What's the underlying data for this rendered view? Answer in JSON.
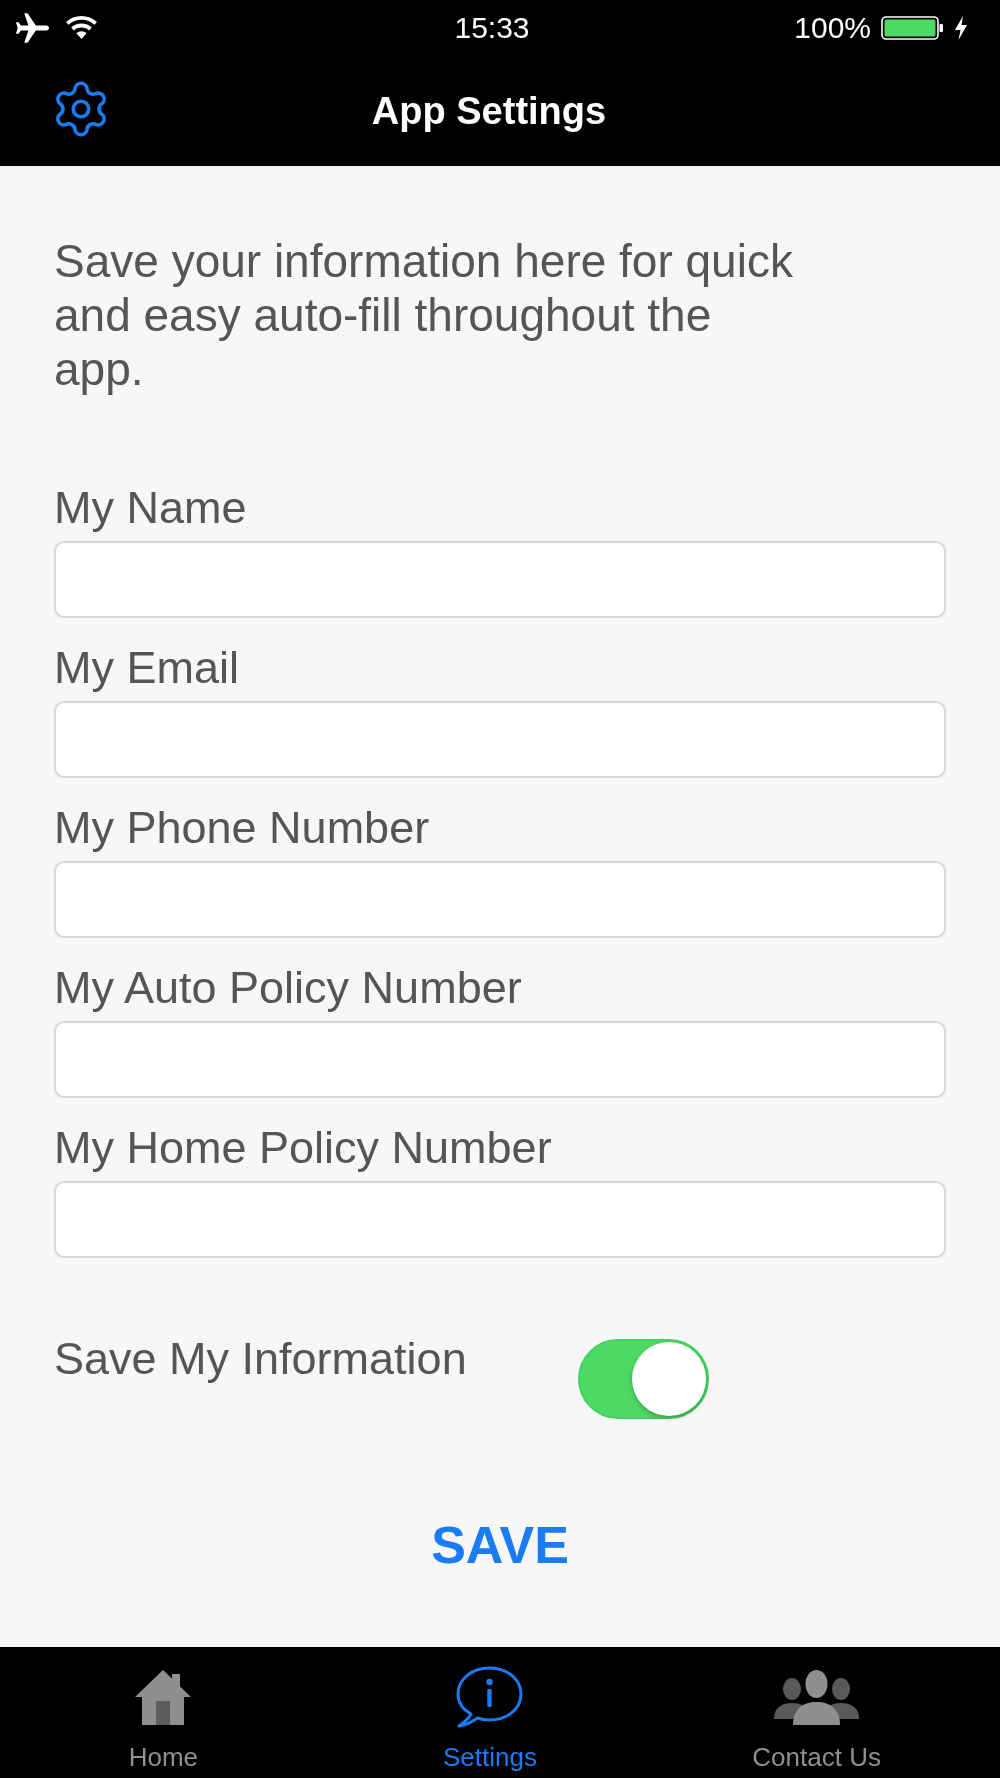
{
  "status_bar": {
    "time": "15:33",
    "battery": "100%"
  },
  "nav_bar": {
    "title": "App Settings"
  },
  "intro": "Save your information here for quick and easy auto-fill throughout the app.",
  "fields": [
    {
      "label": "My Name"
    },
    {
      "label": "My Email"
    },
    {
      "label": "My Phone Number"
    },
    {
      "label": "My Auto Policy Number"
    },
    {
      "label": "My Home Policy Number"
    }
  ],
  "save_information": {
    "label": "Save My Information",
    "on": true
  },
  "save_button": "SAVE",
  "tabs": [
    {
      "label": "Home",
      "selected": false
    },
    {
      "label": "Settings",
      "selected": true
    },
    {
      "label": "Contact Us",
      "selected": false
    }
  ]
}
